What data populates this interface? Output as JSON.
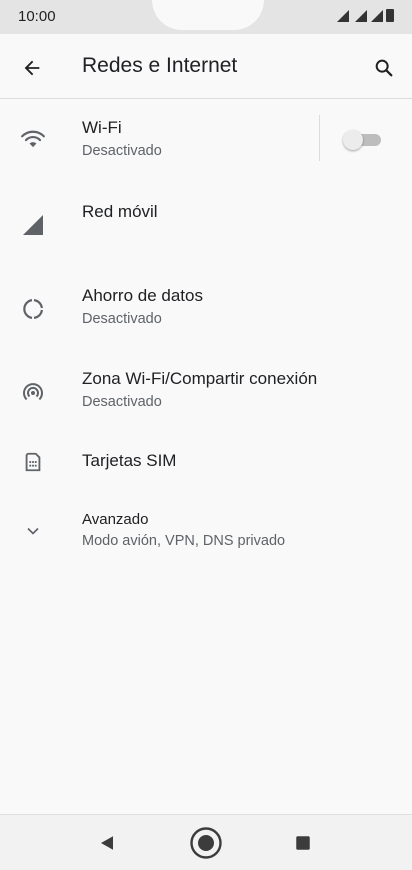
{
  "status_bar": {
    "time": "10:00"
  },
  "app_bar": {
    "title": "Redes e Internet",
    "back_icon": "arrow-back-icon",
    "search_icon": "search-icon"
  },
  "items": [
    {
      "icon": "wifi-icon",
      "label": "Wi-Fi",
      "sublabel": "Desactivado",
      "toggle": "off"
    },
    {
      "icon": "cellular-signal-icon",
      "label": "Red móvil"
    },
    {
      "icon": "data-saver-icon",
      "label": "Ahorro de datos",
      "sublabel": "Desactivado"
    },
    {
      "icon": "hotspot-icon",
      "label": "Zona Wi-Fi/Compartir conexión",
      "sublabel": "Desactivado"
    },
    {
      "icon": "sim-card-icon",
      "label": "Tarjetas SIM"
    },
    {
      "icon": "chevron-down-icon",
      "label": "Avanzado",
      "sublabel": "Modo avión, VPN, DNS privado"
    }
  ],
  "nav_bar": {
    "back": "nav-back-icon",
    "home": "nav-home-icon",
    "recents": "nav-recents-icon"
  },
  "colors": {
    "background": "#f9f9f9",
    "status_bar": "#e4e4e4",
    "icon": "#5f6368"
  }
}
